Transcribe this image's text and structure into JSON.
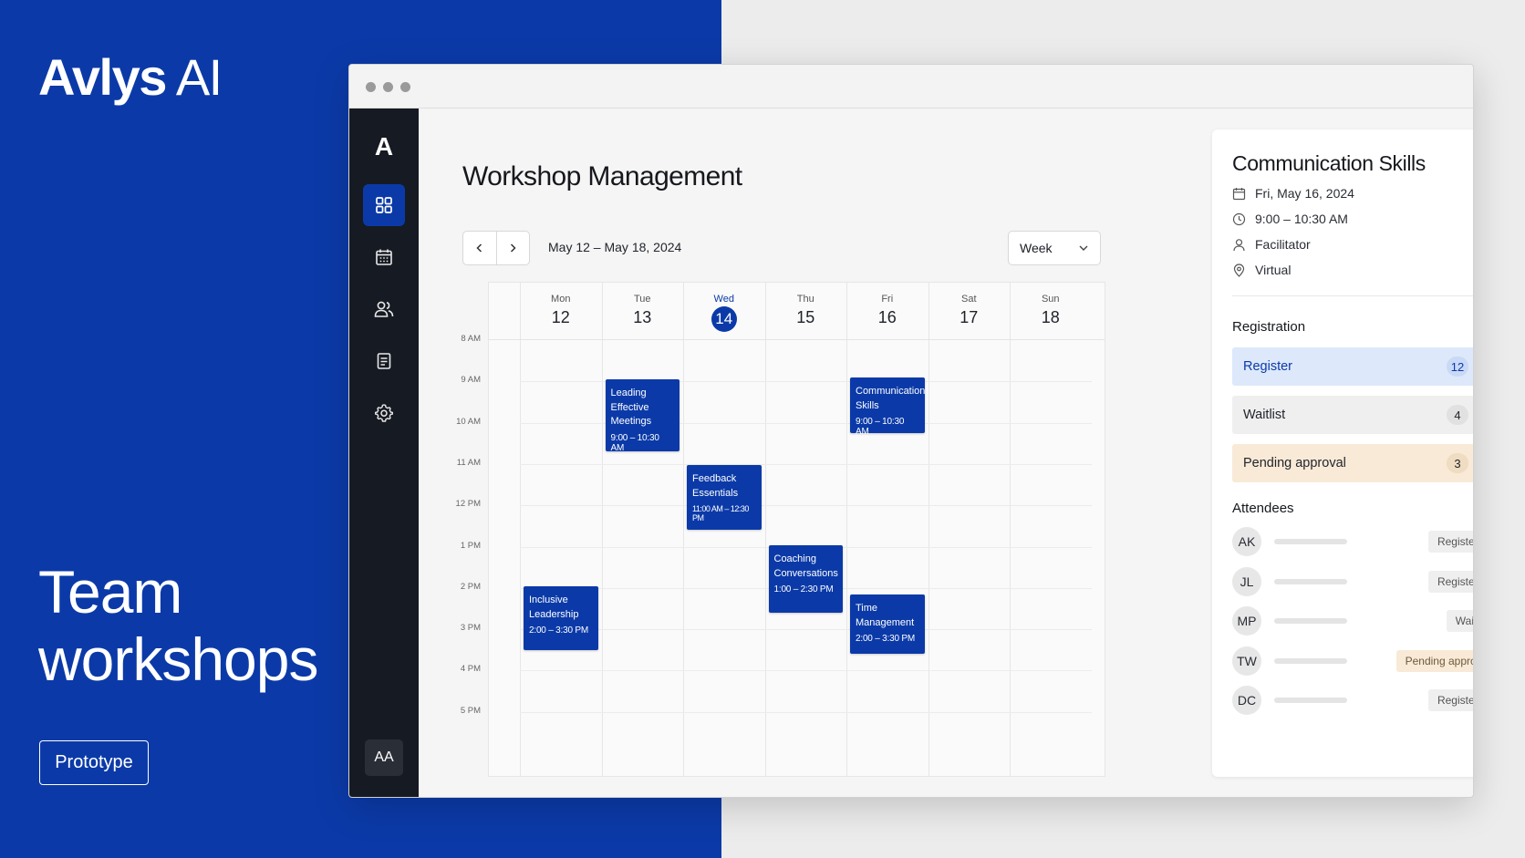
{
  "brand": {
    "strong": "Avlys",
    "light": "AI"
  },
  "hero": {
    "line1": "Team",
    "line2": "workshops"
  },
  "tag": "Prototype",
  "rail": {
    "logo": "A",
    "avatar": "AA",
    "items": [
      {
        "icon": "dashboard-grid-icon",
        "active": true
      },
      {
        "icon": "calendar-icon",
        "active": false
      },
      {
        "icon": "users-icon",
        "active": false
      },
      {
        "icon": "document-icon",
        "active": false
      },
      {
        "icon": "settings-gear-icon",
        "active": false
      }
    ]
  },
  "page": {
    "title": "Workshop Management",
    "date_range": "May 12 – May 18, 2024",
    "view": "Week"
  },
  "calendar": {
    "days": [
      {
        "name": "Mon",
        "num": "12",
        "today": false
      },
      {
        "name": "Tue",
        "num": "13",
        "today": false
      },
      {
        "name": "Wed",
        "num": "14",
        "today": true
      },
      {
        "name": "Thu",
        "num": "15",
        "today": false
      },
      {
        "name": "Fri",
        "num": "16",
        "today": false
      },
      {
        "name": "Sat",
        "num": "17",
        "today": false
      },
      {
        "name": "Sun",
        "num": "18",
        "today": false
      }
    ],
    "times": [
      "8 AM",
      "9 AM",
      "10 AM",
      "11 AM",
      "12 PM",
      "1 PM",
      "2 PM",
      "3 PM",
      "4 PM",
      "5 PM"
    ],
    "events": [
      {
        "title_lines": [
          "Leading",
          "Effective",
          "Meetings"
        ],
        "time": "9:00 – 10:30 AM"
      },
      {
        "title_lines": [
          "Communication",
          "Skills"
        ],
        "time": "9:00 – 10:30 AM"
      },
      {
        "title_lines": [
          "Feedback",
          "Essentials"
        ],
        "time": "11:00 AM – 12:30 PM"
      },
      {
        "title_lines": [
          "Coaching",
          "Conversations"
        ],
        "time": "1:00 – 2:30 PM"
      },
      {
        "title_lines": [
          "Inclusive",
          "Leadership"
        ],
        "time": "2:00 – 3:30 PM"
      },
      {
        "title_lines": [
          "Time",
          "Management"
        ],
        "time": "2:00 – 3:30 PM"
      }
    ]
  },
  "detail": {
    "title": "Communication Skills",
    "date": "Fri, May 16, 2024",
    "time": "9:00 – 10:30 AM",
    "role": "Facilitator",
    "location": "Virtual",
    "registration_heading": "Registration",
    "registration": [
      {
        "label": "Register",
        "count": "12",
        "tone": "blue"
      },
      {
        "label": "Waitlist",
        "count": "4",
        "tone": "gray"
      },
      {
        "label": "Pending approval",
        "count": "3",
        "tone": "amber"
      }
    ],
    "attendees_heading": "Attendees",
    "attendees": [
      {
        "initials": "AK",
        "status": "Registered"
      },
      {
        "initials": "JL",
        "status": "Registered"
      },
      {
        "initials": "MP",
        "status": "Waitlist"
      },
      {
        "initials": "TW",
        "status": "Pending approval"
      },
      {
        "initials": "DC",
        "status": "Registered"
      }
    ]
  },
  "colors": {
    "brand_blue": "#0b3aa8",
    "rail": "#161a22",
    "amber": "#f8ead7",
    "light_blue": "#dde8fb"
  }
}
